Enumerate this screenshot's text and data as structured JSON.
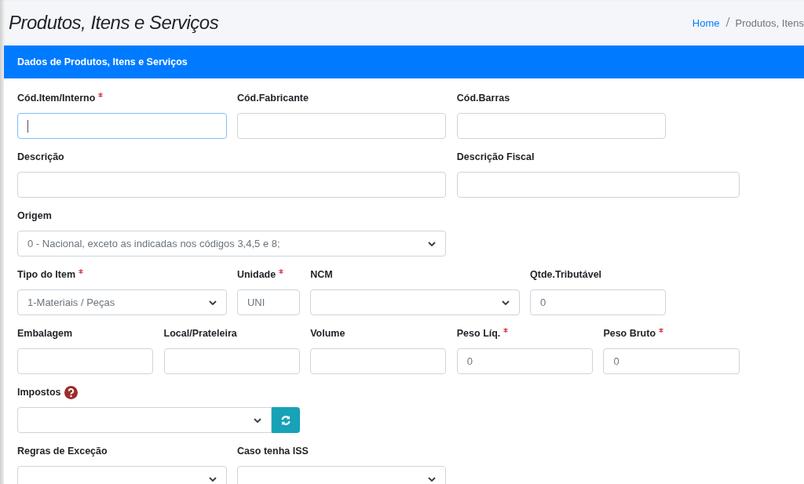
{
  "page_title": "Produtos, Itens e Serviços",
  "breadcrumb": [
    {
      "label": "Home",
      "kind": "link"
    },
    {
      "label": "Produtos, Itens",
      "kind": "current"
    }
  ],
  "card": {
    "title": "Dados de Produtos, Itens e Serviços",
    "rows": [
      [
        {
          "label": "Cód.Item/Interno",
          "required": true,
          "kind": "input",
          "focused": true
        },
        {
          "label": "Cód.Fabricante",
          "required": false,
          "kind": "input",
          "focused": false
        },
        {
          "label": "Cód.Barras",
          "required": false,
          "kind": "input",
          "focused": false
        }
      ],
      [
        {
          "label": "Descrição",
          "required": false,
          "kind": "input",
          "focused": false
        },
        {
          "label": "Descrição Fiscal",
          "required": false,
          "kind": "input",
          "focused": false
        }
      ],
      [
        {
          "label": "Origem",
          "required": false,
          "kind": "select",
          "value": "0 - Nacional, exceto as indicadas nos códigos 3,4,5 e 8;"
        }
      ],
      [
        {
          "label": "Tipo do Item",
          "required": true,
          "kind": "select",
          "value": "1-Materiais / Peças"
        },
        {
          "label": "Unidade",
          "required": true,
          "kind": "input",
          "focused": false,
          "value": "UNI"
        },
        {
          "label": "NCM",
          "required": false,
          "kind": "select"
        },
        {
          "label": "Qtde.Tributável",
          "required": false,
          "kind": "input",
          "focused": false,
          "value": "0"
        }
      ],
      [
        {
          "label": "Embalagem",
          "required": false,
          "kind": "input",
          "focused": false
        },
        {
          "label": "Local/Prateleira",
          "required": false,
          "kind": "input",
          "focused": false
        },
        {
          "label": "Volume",
          "required": false,
          "kind": "input",
          "focused": false
        },
        {
          "label": "Peso Líq.",
          "required": true,
          "kind": "input",
          "focused": false,
          "value": "0"
        },
        {
          "label": "Peso Bruto",
          "required": true,
          "kind": "input",
          "focused": false,
          "value": "0"
        }
      ],
      [
        {
          "label": "Impostos",
          "required": false,
          "kind": "select-refresh",
          "help": true
        }
      ],
      [
        {
          "label": "Regras de Exceção",
          "required": false,
          "kind": "select"
        },
        {
          "label": "Caso tenha ISS",
          "required": false,
          "kind": "select"
        }
      ]
    ]
  }
}
